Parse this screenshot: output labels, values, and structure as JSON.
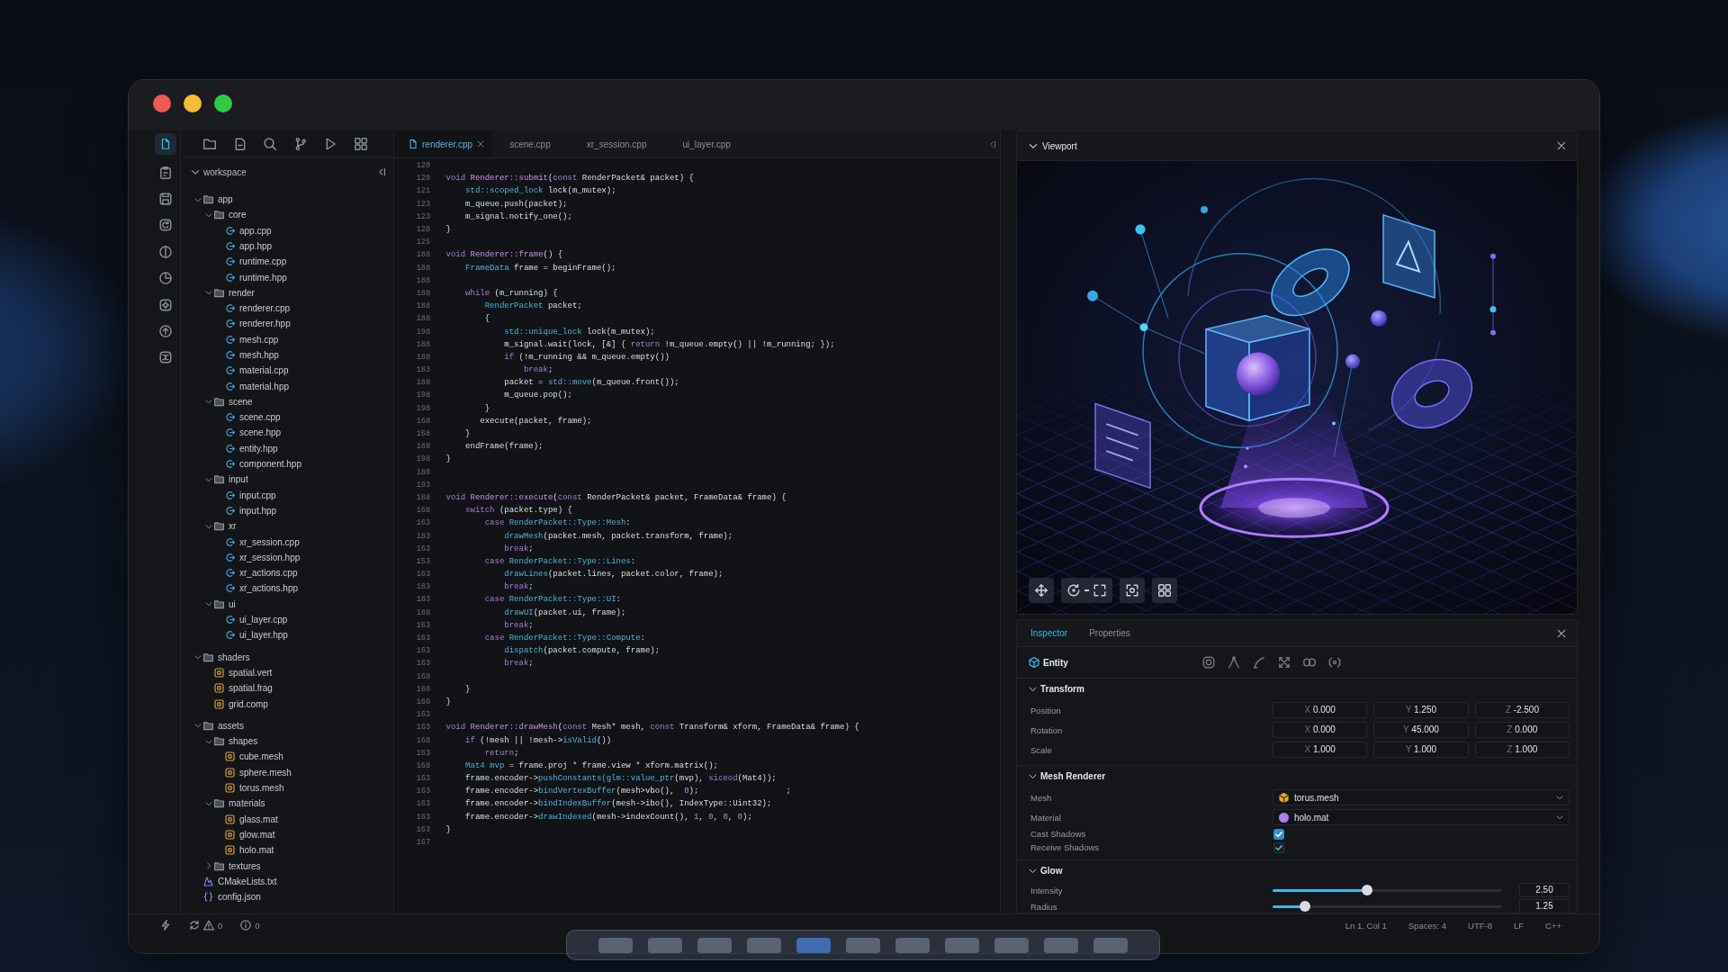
{
  "activity_bar": [
    {
      "selected": true
    },
    {
      "selected": false
    },
    {
      "selected": false
    },
    {
      "selected": false
    },
    {
      "selected": false
    },
    {
      "selected": false
    },
    {
      "selected": false
    },
    {
      "selected": false
    },
    {
      "selected": false
    }
  ],
  "sidebar": {
    "title": "workspace",
    "tree": [
      {
        "name": "app",
        "kind": "folder",
        "expanded": true,
        "children": [
          {
            "name": "core",
            "kind": "folder",
            "expanded": true,
            "children": [
              {
                "name": "app.cpp",
                "kind": "source"
              },
              {
                "name": "app.hpp",
                "kind": "source"
              },
              {
                "name": "runtime.cpp",
                "kind": "source"
              },
              {
                "name": "runtime.hpp",
                "kind": "source"
              }
            ]
          },
          {
            "name": "render",
            "kind": "folder",
            "expanded": true,
            "children": [
              {
                "name": "renderer.cpp",
                "kind": "source"
              },
              {
                "name": "renderer.hpp",
                "kind": "source"
              },
              {
                "name": "mesh.cpp",
                "kind": "source"
              },
              {
                "name": "mesh.hpp",
                "kind": "source"
              },
              {
                "name": "material.cpp",
                "kind": "source"
              },
              {
                "name": "material.hpp",
                "kind": "source"
              }
            ]
          },
          {
            "name": "scene",
            "kind": "folder",
            "expanded": true,
            "children": [
              {
                "name": "scene.cpp",
                "kind": "source"
              },
              {
                "name": "scene.hpp",
                "kind": "source"
              },
              {
                "name": "entity.hpp",
                "kind": "source"
              },
              {
                "name": "component.hpp",
                "kind": "source"
              }
            ]
          },
          {
            "name": "input",
            "kind": "folder",
            "expanded": true,
            "children": [
              {
                "name": "input.cpp",
                "kind": "source"
              },
              {
                "name": "input.hpp",
                "kind": "source"
              }
            ]
          },
          {
            "name": "xr",
            "kind": "folder",
            "expanded": true,
            "children": [
              {
                "name": "xr_session.cpp",
                "kind": "source"
              },
              {
                "name": "xr_session.hpp",
                "kind": "source"
              },
              {
                "name": "xr_actions.cpp",
                "kind": "source"
              },
              {
                "name": "xr_actions.hpp",
                "kind": "source"
              }
            ]
          },
          {
            "name": "ui",
            "kind": "folder",
            "expanded": true,
            "children": [
              {
                "name": "ui_layer.cpp",
                "kind": "source"
              },
              {
                "name": "ui_layer.hpp",
                "kind": "source"
              }
            ]
          }
        ]
      },
      {
        "name": "shaders",
        "kind": "folder",
        "expanded": true,
        "children": [
          {
            "name": "spatial.vert",
            "kind": "asset"
          },
          {
            "name": "spatial.frag",
            "kind": "asset"
          },
          {
            "name": "grid.comp",
            "kind": "asset"
          }
        ]
      },
      {
        "name": "assets",
        "kind": "folder",
        "expanded": true,
        "children": [
          {
            "name": "shapes",
            "kind": "folder",
            "expanded": true,
            "children": [
              {
                "name": "cube.mesh",
                "kind": "asset"
              },
              {
                "name": "sphere.mesh",
                "kind": "asset"
              },
              {
                "name": "torus.mesh",
                "kind": "asset"
              }
            ]
          },
          {
            "name": "materials",
            "kind": "folder",
            "expanded": true,
            "children": [
              {
                "name": "glass.mat",
                "kind": "asset"
              },
              {
                "name": "glow.mat",
                "kind": "asset"
              },
              {
                "name": "holo.mat",
                "kind": "asset"
              }
            ]
          },
          {
            "name": "textures",
            "kind": "folder",
            "expanded": false
          }
        ]
      },
      {
        "name": "CMakeLists.txt",
        "kind": "cmake"
      },
      {
        "name": "config.json",
        "kind": "json"
      }
    ]
  },
  "editor": {
    "tabs": [
      {
        "label": "renderer.cpp",
        "selected": true
      },
      {
        "label": "scene.cpp",
        "selected": false
      },
      {
        "label": "xr_session.cpp",
        "selected": false
      },
      {
        "label": "ui_layer.cpp",
        "selected": false
      }
    ],
    "lines": [
      {
        "number": "120"
      },
      {
        "number": "120",
        "tokens": [
          {
            "kind": "keyword",
            "text": "void "
          },
          {
            "kind": "function",
            "text": "Renderer::submit"
          },
          {
            "kind": "text",
            "text": "("
          },
          {
            "kind": "keyword",
            "text": "const "
          },
          {
            "kind": "text",
            "text": "RenderPacket& packet) {"
          }
        ]
      },
      {
        "number": "121",
        "tokens": [
          {
            "kind": "type",
            "text": "    std::scoped_lock"
          },
          {
            "kind": "text",
            "text": " lock(m_mutex);"
          }
        ]
      },
      {
        "number": "123",
        "tokens": [
          {
            "kind": "text",
            "text": "    m_queue.push(packet);"
          }
        ]
      },
      {
        "number": "123",
        "tokens": [
          {
            "kind": "text",
            "text": "    m_signal.notify_one();"
          }
        ]
      },
      {
        "number": "128",
        "tokens": [
          {
            "kind": "text",
            "text": "}"
          }
        ]
      },
      {
        "number": "125"
      },
      {
        "number": "188",
        "tokens": [
          {
            "kind": "keyword",
            "text": "void "
          },
          {
            "kind": "function",
            "text": "Renderer::frame"
          },
          {
            "kind": "text",
            "text": "() {"
          }
        ]
      },
      {
        "number": "188",
        "tokens": [
          {
            "kind": "type",
            "text": "    FrameData"
          },
          {
            "kind": "text",
            "text": " frame = beginFrame();"
          }
        ]
      },
      {
        "number": "188"
      },
      {
        "number": "188",
        "tokens": [
          {
            "kind": "keyword",
            "text": "    while"
          },
          {
            "kind": "text",
            "text": " (m_running) {"
          }
        ]
      },
      {
        "number": "188",
        "tokens": [
          {
            "kind": "type",
            "text": "        RenderPacket"
          },
          {
            "kind": "text",
            "text": " packet;"
          }
        ]
      },
      {
        "number": "188",
        "tokens": [
          {
            "kind": "text",
            "text": "        {"
          }
        ]
      },
      {
        "number": "198",
        "tokens": [
          {
            "kind": "type",
            "text": "            std::unique_lock"
          },
          {
            "kind": "text",
            "text": " lock(m_mutex);"
          }
        ]
      },
      {
        "number": "188",
        "tokens": [
          {
            "kind": "text",
            "text": "            m_signal.wait(lock, [&] { "
          },
          {
            "kind": "keyword",
            "text": "return"
          },
          {
            "kind": "text",
            "text": " !m_queue.empty() || !m_running; });"
          }
        ]
      },
      {
        "number": "188",
        "tokens": [
          {
            "kind": "keyword",
            "text": "            if"
          },
          {
            "kind": "text",
            "text": " (!m_running && m_queue.empty())"
          }
        ]
      },
      {
        "number": "183",
        "tokens": [
          {
            "kind": "keyword",
            "text": "                break"
          },
          {
            "kind": "text",
            "text": ";"
          }
        ]
      },
      {
        "number": "188",
        "tokens": [
          {
            "kind": "text",
            "text": "            packet = "
          },
          {
            "kind": "type",
            "text": "std::move"
          },
          {
            "kind": "text",
            "text": "(m_queue.front());"
          }
        ]
      },
      {
        "number": "198",
        "tokens": [
          {
            "kind": "text",
            "text": "            m_queue.pop();"
          }
        ]
      },
      {
        "number": "198",
        "tokens": [
          {
            "kind": "text",
            "text": "        }"
          }
        ]
      },
      {
        "number": "168",
        "tokens": [
          {
            "kind": "text",
            "text": "       execute(packet, frame);"
          }
        ]
      },
      {
        "number": "168",
        "tokens": [
          {
            "kind": "text",
            "text": "    }"
          }
        ]
      },
      {
        "number": "188",
        "tokens": [
          {
            "kind": "text",
            "text": "    endFrame(frame);"
          }
        ]
      },
      {
        "number": "198",
        "tokens": [
          {
            "kind": "text",
            "text": "}"
          }
        ]
      },
      {
        "number": "180"
      },
      {
        "number": "193"
      },
      {
        "number": "188",
        "tokens": [
          {
            "kind": "keyword",
            "text": "void "
          },
          {
            "kind": "function",
            "text": "Renderer::execute"
          },
          {
            "kind": "text",
            "text": "("
          },
          {
            "kind": "keyword",
            "text": "const "
          },
          {
            "kind": "text",
            "text": "RenderPacket& packet, FrameData& frame) {"
          }
        ]
      },
      {
        "number": "168",
        "tokens": [
          {
            "kind": "keyword",
            "text": "    switch"
          },
          {
            "kind": "text",
            "text": " (packet.type) {"
          }
        ]
      },
      {
        "number": "163",
        "tokens": [
          {
            "kind": "keyword",
            "text": "        case "
          },
          {
            "kind": "type",
            "text": "RenderPacket::Type::Mesh"
          },
          {
            "kind": "text",
            "text": ":"
          }
        ]
      },
      {
        "number": "183",
        "tokens": [
          {
            "kind": "type",
            "text": "            drawMesh"
          },
          {
            "kind": "text",
            "text": "(packet.mesh, packet.transform, frame);"
          }
        ]
      },
      {
        "number": "163",
        "tokens": [
          {
            "kind": "keyword",
            "text": "            break"
          },
          {
            "kind": "text",
            "text": ";"
          }
        ]
      },
      {
        "number": "153",
        "tokens": [
          {
            "kind": "keyword",
            "text": "        case "
          },
          {
            "kind": "type",
            "text": "RenderPacket::Type::Lines"
          },
          {
            "kind": "text",
            "text": ":"
          }
        ]
      },
      {
        "number": "163",
        "tokens": [
          {
            "kind": "type",
            "text": "            drawLines"
          },
          {
            "kind": "text",
            "text": "(packet.lines, packet.color, frame);"
          }
        ]
      },
      {
        "number": "183",
        "tokens": [
          {
            "kind": "keyword",
            "text": "            break"
          },
          {
            "kind": "text",
            "text": ";"
          }
        ]
      },
      {
        "number": "183",
        "tokens": [
          {
            "kind": "keyword",
            "text": "        case "
          },
          {
            "kind": "type",
            "text": "RenderPacket::Type::UI"
          },
          {
            "kind": "text",
            "text": ":"
          }
        ]
      },
      {
        "number": "188",
        "tokens": [
          {
            "kind": "type",
            "text": "            drawUI"
          },
          {
            "kind": "text",
            "text": "(packet.ui, frame);"
          }
        ]
      },
      {
        "number": "163",
        "tokens": [
          {
            "kind": "keyword",
            "text": "            break"
          },
          {
            "kind": "text",
            "text": ";"
          }
        ]
      },
      {
        "number": "163",
        "tokens": [
          {
            "kind": "keyword",
            "text": "        case "
          },
          {
            "kind": "type",
            "text": "RenderPacket::Type::Compute"
          },
          {
            "kind": "text",
            "text": ":"
          }
        ]
      },
      {
        "number": "163",
        "tokens": [
          {
            "kind": "type",
            "text": "            dispatch"
          },
          {
            "kind": "text",
            "text": "(packet.compute, frame);"
          }
        ]
      },
      {
        "number": "163",
        "tokens": [
          {
            "kind": "keyword",
            "text": "            break"
          },
          {
            "kind": "text",
            "text": ";"
          }
        ]
      },
      {
        "number": "168"
      },
      {
        "number": "160",
        "tokens": [
          {
            "kind": "text",
            "text": "    }"
          }
        ]
      },
      {
        "number": "166",
        "tokens": [
          {
            "kind": "text",
            "text": "}"
          }
        ]
      },
      {
        "number": "163"
      },
      {
        "number": "163",
        "tokens": [
          {
            "kind": "keyword",
            "text": "void "
          },
          {
            "kind": "function",
            "text": "Renderer::drawMesh"
          },
          {
            "kind": "text",
            "text": "("
          },
          {
            "kind": "keyword",
            "text": "const "
          },
          {
            "kind": "text",
            "text": "Mesh* mesh, "
          },
          {
            "kind": "keyword",
            "text": "const "
          },
          {
            "kind": "text",
            "text": "Transform& xform, FrameData& frame) {"
          }
        ]
      },
      {
        "number": "168",
        "tokens": [
          {
            "kind": "keyword",
            "text": "    if"
          },
          {
            "kind": "text",
            "text": " (!mesh || !mesh->"
          },
          {
            "kind": "type",
            "text": "isValid"
          },
          {
            "kind": "text",
            "text": "())"
          }
        ]
      },
      {
        "number": "163",
        "tokens": [
          {
            "kind": "keyword",
            "text": "        return"
          },
          {
            "kind": "text",
            "text": ";"
          }
        ]
      },
      {
        "number": "168",
        "tokens": [
          {
            "kind": "type",
            "text": "    Mat4 mvp"
          },
          {
            "kind": "text",
            "text": " = frame.proj * frame.view * xform.matrix();"
          }
        ]
      },
      {
        "number": "163",
        "tokens": [
          {
            "kind": "text",
            "text": "    frame.encoder->"
          },
          {
            "kind": "type",
            "text": "pushConstants(glm::value_ptr"
          },
          {
            "kind": "text",
            "text": "(mvp), "
          },
          {
            "kind": "keyword",
            "text": "siceod"
          },
          {
            "kind": "text",
            "text": "(Mat4));"
          }
        ]
      },
      {
        "number": "163",
        "tokens": [
          {
            "kind": "text",
            "text": "    frame.encoder->"
          },
          {
            "kind": "type",
            "text": "bindVertexBuffer"
          },
          {
            "kind": "text",
            "text": "(mesh>vbo(),  "
          },
          {
            "kind": "number",
            "text": "0"
          },
          {
            "kind": "text",
            "text": ");                  ;"
          }
        ]
      },
      {
        "number": "163",
        "tokens": [
          {
            "kind": "text",
            "text": "    frame.encoder->"
          },
          {
            "kind": "type",
            "text": "bindIndexBuffer"
          },
          {
            "kind": "text",
            "text": "(mesh->ibo(), IndexType::Uint32);"
          }
        ]
      },
      {
        "number": "163",
        "tokens": [
          {
            "kind": "text",
            "text": "    frame.encoder->"
          },
          {
            "kind": "type",
            "text": "drawIndexed"
          },
          {
            "kind": "text",
            "text": "(mesh->indexCount(), "
          },
          {
            "kind": "number",
            "text": "1"
          },
          {
            "kind": "text",
            "text": ", "
          },
          {
            "kind": "number",
            "text": "0"
          },
          {
            "kind": "text",
            "text": ", "
          },
          {
            "kind": "number",
            "text": "0"
          },
          {
            "kind": "text",
            "text": ", "
          },
          {
            "kind": "number",
            "text": "0"
          },
          {
            "kind": "text",
            "text": ");"
          }
        ]
      },
      {
        "number": "163",
        "tokens": [
          {
            "kind": "text",
            "text": "}"
          }
        ]
      },
      {
        "number": "167"
      }
    ]
  },
  "viewport": {
    "title": "Viewport"
  },
  "inspector": {
    "tabs": [
      {
        "label": "Inspector",
        "selected": true
      },
      {
        "label": "Properties",
        "selected": false
      }
    ],
    "entity": "Entity",
    "sections": [
      {
        "title": "Transform",
        "expanded": true,
        "rows": [
          {
            "kind": "vector",
            "label": "Position",
            "fields": [
              {
                "axis": "X",
                "value": "0.000"
              },
              {
                "axis": "Y",
                "value": "1.250"
              },
              {
                "axis": "Z",
                "value": "-2.500"
              }
            ]
          },
          {
            "kind": "vector",
            "label": "Rotation",
            "fields": [
              {
                "axis": "X",
                "value": "0.000"
              },
              {
                "axis": "Y",
                "value": "45.000"
              },
              {
                "axis": "Z",
                "value": "0.000"
              }
            ]
          },
          {
            "kind": "vector",
            "label": "Scale",
            "fields": [
              {
                "axis": "X",
                "value": "1.000"
              },
              {
                "axis": "Y",
                "value": "1.000"
              },
              {
                "axis": "Z",
                "value": "1.000"
              }
            ]
          }
        ]
      },
      {
        "title": "Mesh Renderer",
        "expanded": true,
        "rows": [
          {
            "kind": "dropdown",
            "label": "Mesh",
            "selection": {
              "kind": "mesh",
              "text": "torus.mesh"
            }
          },
          {
            "kind": "dropdown",
            "label": "Material",
            "selection": {
              "kind": "material",
              "text": "holo.mat"
            }
          },
          {
            "kind": "checkbox",
            "label": "Cast Shadows",
            "checked": true,
            "highlighted": true
          },
          {
            "kind": "checkbox",
            "label": "Receive Shadows",
            "checked": true,
            "highlighted": false
          }
        ]
      },
      {
        "title": "Glow",
        "expanded": true,
        "rows": [
          {
            "kind": "slider",
            "label": "Intensity",
            "level": 0.41,
            "reading": "2.50"
          },
          {
            "kind": "slider",
            "label": "Radius",
            "level": 0.14,
            "reading": "1.25"
          }
        ]
      }
    ]
  },
  "status_bar": {
    "warnings": "0",
    "infos": "0",
    "position": "Ln 1, Col 1",
    "indentation": "Spaces: 4",
    "encoding": "UTF-8",
    "line_ending": "LF",
    "language": "C++"
  },
  "dock": {
    "items": [
      {
        "selected": false
      },
      {
        "selected": false
      },
      {
        "selected": false
      },
      {
        "selected": false
      },
      {
        "selected": true
      },
      {
        "selected": false
      },
      {
        "selected": false
      },
      {
        "selected": false
      },
      {
        "selected": false
      },
      {
        "selected": false
      },
      {
        "selected": false
      }
    ]
  }
}
